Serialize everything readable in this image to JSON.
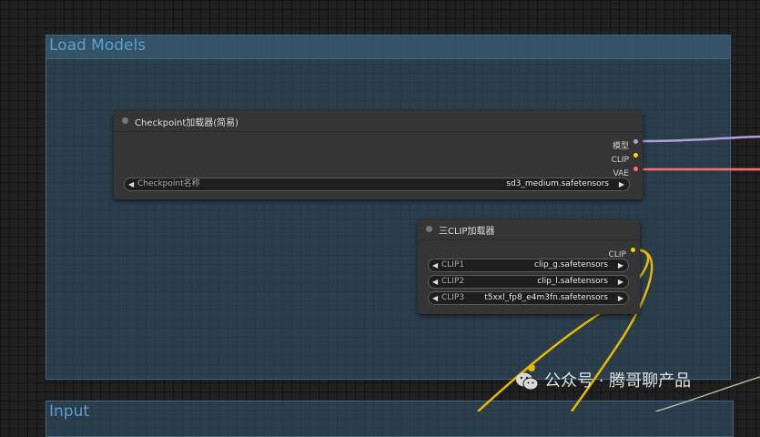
{
  "canvas": {
    "group_load_models": {
      "title": "Load Models"
    },
    "group_input": {
      "title": "Input"
    }
  },
  "checkpoint_node": {
    "title": "Checkpoint加载器(简易)",
    "outputs": [
      {
        "label": "模型",
        "color": "#b39ddb"
      },
      {
        "label": "CLIP",
        "color": "#ffd500"
      },
      {
        "label": "VAE",
        "color": "#ff6e6e"
      }
    ],
    "widget": {
      "label": "Checkpoint名称",
      "value": "sd3_medium.safetensors"
    }
  },
  "triple_clip_node": {
    "title": "三CLIP加载器",
    "outputs": [
      {
        "label": "CLIP",
        "color": "#ffd500"
      }
    ],
    "widgets": [
      {
        "label": "CLIP1",
        "value": "clip_g.safetensors"
      },
      {
        "label": "CLIP2",
        "value": "clip_l.safetensors"
      },
      {
        "label": "CLIP3",
        "value": "t5xxl_fp8_e4m3fn.safetensors"
      }
    ]
  },
  "watermark": {
    "text": "公众号 · 腾哥聊产品"
  },
  "icons": {
    "arrow_left": "◀",
    "arrow_right": "▶"
  },
  "wire_colors": {
    "model": "#b39ddb",
    "clip": "#ffd500",
    "vae": "#ff6e6e",
    "other": "#c8c8c8"
  }
}
